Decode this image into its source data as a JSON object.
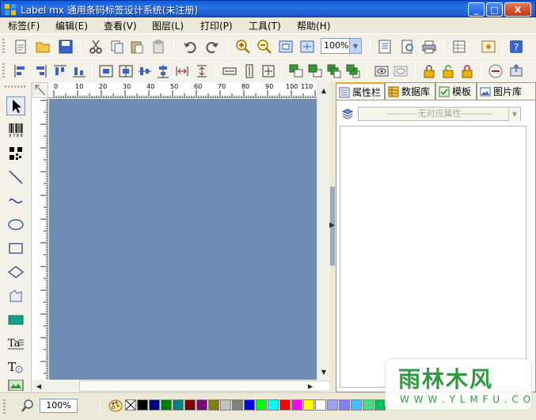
{
  "window": {
    "title": "Label mx 通用条码标签设计系统(未注册)",
    "controls": [
      "_",
      "□",
      "X"
    ]
  },
  "menu": [
    "标签(F)",
    "编辑(E)",
    "查看(V)",
    "图层(L)",
    "打印(P)",
    "工具(T)",
    "帮助(H)"
  ],
  "toolbar": {
    "zoom_value": "100%",
    "tools_row1": [
      "new-file-icon",
      "open-folder-icon",
      "save-icon",
      "cut-icon",
      "copy-icon",
      "paste-icon",
      "clear-icon",
      "undo-icon",
      "redo-icon",
      "zoom-in-icon",
      "zoom-out-icon",
      "fit-page-icon",
      "actual-size-icon",
      "print-settings-icon",
      "print-preview-icon",
      "print-icon",
      "grid-icon",
      "layout-icon",
      "help-icon"
    ],
    "tools_row2": [
      "align-left-icon",
      "align-right-icon",
      "align-top-icon",
      "align-bottom-icon",
      "center-horizontal-icon",
      "center-vertical-icon",
      "align-middle-icon",
      "align-center-icon",
      "distribute-horizontal-icon",
      "distribute-vertical-icon",
      "same-width-icon",
      "same-height-icon",
      "same-size-icon",
      "bring-front-icon",
      "send-back-icon",
      "bring-forward-icon",
      "send-backward-icon",
      "show-icon",
      "hide-icon",
      "lock-icon",
      "unlock-icon",
      "lock-size-icon",
      "print-cancel-icon",
      "export-icon"
    ]
  },
  "palette": [
    "select-arrow-icon",
    "barcode-icon",
    "qrcode-icon",
    "line-icon",
    "curve-icon",
    "ellipse-icon",
    "rectangle-icon",
    "diamond-icon",
    "polygon-icon",
    "fill-rect-icon",
    "text-block-icon",
    "text-icon",
    "image-icon"
  ],
  "ruler": {
    "top_labels": [
      "0",
      "10",
      "20",
      "30",
      "40",
      "50",
      "60",
      "70",
      "80",
      "90",
      "100",
      "110"
    ]
  },
  "right_panel": {
    "tabs": [
      "属性栏",
      "数据库",
      "模板",
      "图片库"
    ],
    "active_tab": "属性栏",
    "property_selector": "----------无对应属性----------"
  },
  "statusbar": {
    "zoom_value": "100%",
    "color_swatches": [
      "#ffffff",
      "#000000",
      "#000080",
      "#008000",
      "#008080",
      "#800000",
      "#800080",
      "#808000",
      "#c0c0c0",
      "#808080",
      "#0000ff",
      "#00ff00",
      "#00ffff",
      "#ff0000",
      "#ff00ff",
      "#ffff00",
      "#ffffff",
      "#a0a0ff",
      "#8080ff",
      "#40c0ff",
      "#40e080",
      "#00c060"
    ]
  },
  "colors": {
    "canvas": "#6e8db5",
    "titlebar": "#0a5fdc",
    "chrome": "#ece9d8"
  },
  "watermark": {
    "main": "雨林木风",
    "url": "W W W . Y L M F U . C O M"
  }
}
